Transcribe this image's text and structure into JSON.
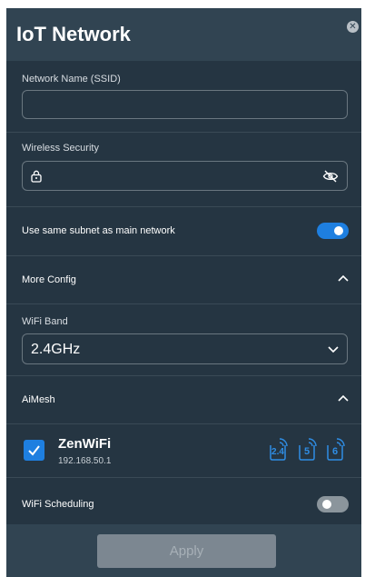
{
  "dialog": {
    "title": "IoT Network",
    "close_icon": "close-icon"
  },
  "ssid": {
    "label": "Network Name (SSID)",
    "value": "",
    "placeholder": ""
  },
  "security": {
    "label": "Wireless Security",
    "value": "",
    "lock_icon": "lock-icon",
    "visibility_icon": "eye-off-icon"
  },
  "subnet": {
    "label": "Use same subnet as main network",
    "enabled": true
  },
  "more_config": {
    "label": "More Config",
    "expanded": true
  },
  "wifi_band": {
    "label": "WiFi Band",
    "selected": "2.4GHz"
  },
  "aimesh": {
    "label": "AiMesh",
    "expanded": true,
    "device": {
      "checked": true,
      "name": "ZenWiFi",
      "ip": "192.168.50.1",
      "bands": [
        "2.4",
        "5",
        "6"
      ]
    }
  },
  "scheduling": {
    "label": "WiFi Scheduling",
    "enabled": false
  },
  "footer": {
    "apply_label": "Apply"
  },
  "colors": {
    "accent": "#1e7fe0",
    "panel": "#253542",
    "header": "#314452"
  }
}
